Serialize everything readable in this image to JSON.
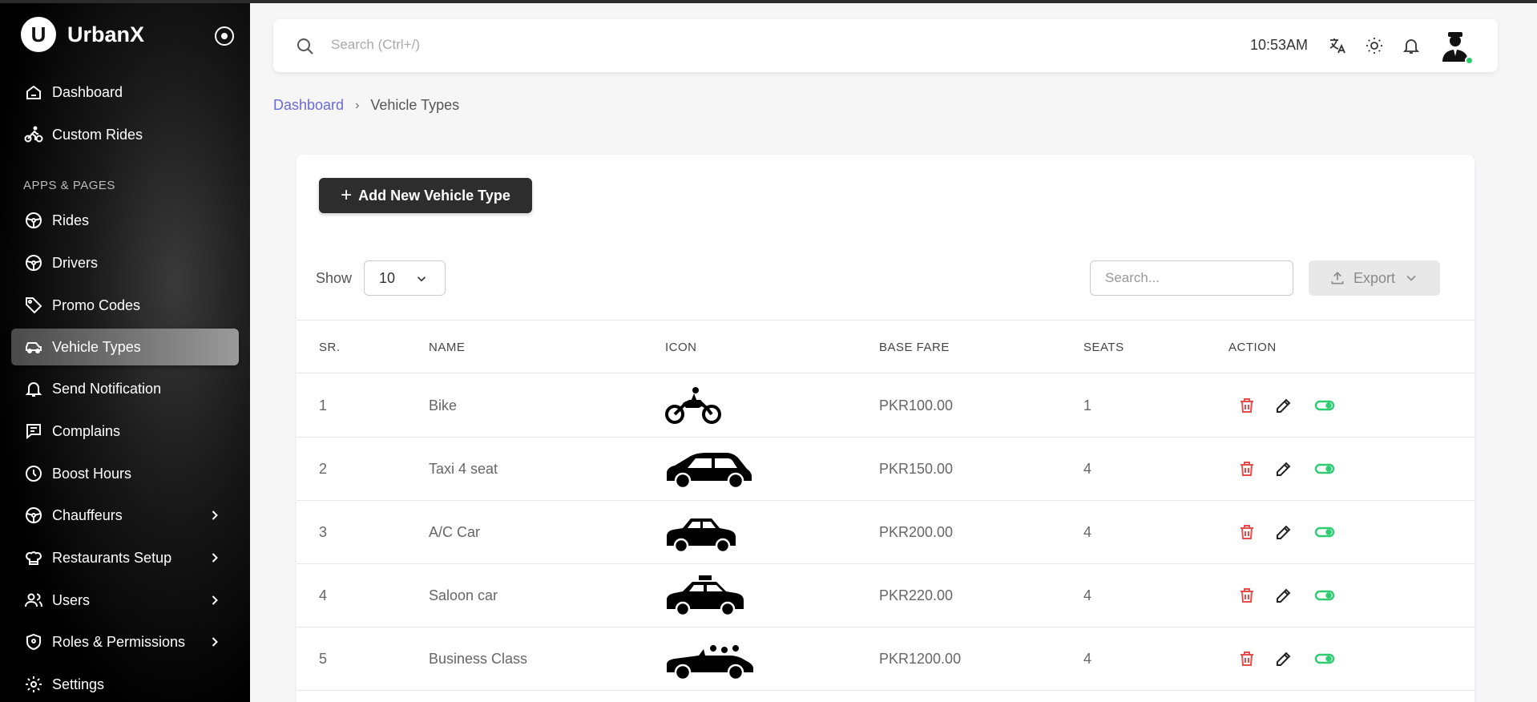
{
  "app": {
    "name": "UrbanX",
    "logo_letter": "U"
  },
  "sidebar": {
    "section_label": "APPS & PAGES",
    "items": [
      {
        "label": "Dashboard",
        "icon": "home-icon"
      },
      {
        "label": "Custom Rides",
        "icon": "bicycle-icon"
      },
      {
        "label": "Rides",
        "icon": "steering-wheel-icon"
      },
      {
        "label": "Drivers",
        "icon": "steering-wheel-icon"
      },
      {
        "label": "Promo Codes",
        "icon": "tag-icon"
      },
      {
        "label": "Vehicle Types",
        "icon": "car-icon",
        "active": true
      },
      {
        "label": "Send Notification",
        "icon": "bell-icon"
      },
      {
        "label": "Complains",
        "icon": "message-icon"
      },
      {
        "label": "Boost Hours",
        "icon": "clock-icon"
      },
      {
        "label": "Chauffeurs",
        "icon": "steering-wheel-icon",
        "has_submenu": true
      },
      {
        "label": "Restaurants Setup",
        "icon": "chef-hat-icon",
        "has_submenu": true
      },
      {
        "label": "Users",
        "icon": "users-icon",
        "has_submenu": true
      },
      {
        "label": "Roles & Permissions",
        "icon": "shield-icon",
        "has_submenu": true
      },
      {
        "label": "Settings",
        "icon": "gear-icon"
      }
    ]
  },
  "topbar": {
    "search_placeholder": "Search (Ctrl+/)",
    "time": "10:53AM",
    "icons": [
      "translate-icon",
      "sun-icon",
      "bell-icon",
      "avatar"
    ]
  },
  "breadcrumb": {
    "parent": "Dashboard",
    "current": "Vehicle Types"
  },
  "toolbar": {
    "add_label": "Add New Vehicle Type",
    "show_label": "Show",
    "show_value": "10",
    "search_placeholder": "Search...",
    "export_label": "Export"
  },
  "table": {
    "columns": [
      "SR.",
      "NAME",
      "ICON",
      "BASE FARE",
      "SEATS",
      "ACTION"
    ],
    "rows": [
      {
        "sr": "1",
        "name": "Bike",
        "icon": "motorbike",
        "base_fare": "PKR100.00",
        "seats": "1"
      },
      {
        "sr": "2",
        "name": "Taxi 4 seat",
        "icon": "hatchback",
        "base_fare": "PKR150.00",
        "seats": "4"
      },
      {
        "sr": "3",
        "name": "A/C Car",
        "icon": "small-car",
        "base_fare": "PKR200.00",
        "seats": "4"
      },
      {
        "sr": "4",
        "name": "Saloon car",
        "icon": "taxi-car",
        "base_fare": "PKR220.00",
        "seats": "4"
      },
      {
        "sr": "5",
        "name": "Business Class",
        "icon": "convertible",
        "base_fare": "PKR1200.00",
        "seats": "4"
      }
    ]
  },
  "colors": {
    "delete": "#e74c4c",
    "toggle": "#2ecc71",
    "breadcrumb_link": "#6b6bd6"
  }
}
